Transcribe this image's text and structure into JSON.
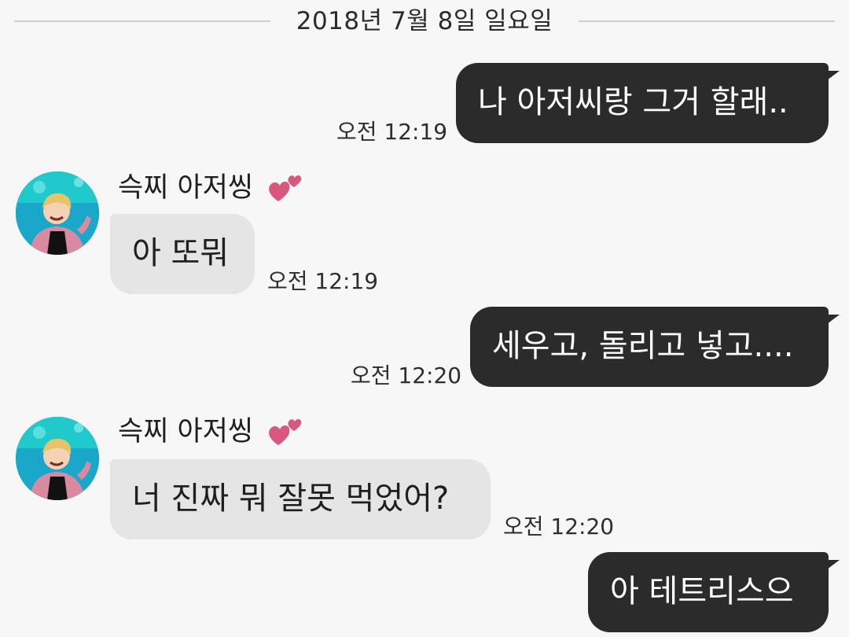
{
  "date_divider": "2018년 7월 8일 일요일",
  "messages": [
    {
      "from": "me",
      "text": "나 아저씨랑 그거 할래..",
      "time": "오전 12:19"
    },
    {
      "from": "contact",
      "sender": "슥찌 아저씽",
      "text": "아 또뭐",
      "time": "오전 12:19"
    },
    {
      "from": "me",
      "text": "세우고, 돌리고 넣고....",
      "time": "오전 12:20"
    },
    {
      "from": "contact",
      "sender": "슥찌 아저씽",
      "text": "너 진짜 뭐 잘못 먹었어?",
      "time": "오전 12:20"
    },
    {
      "from": "me",
      "text": "아 테트리스으",
      "time": ""
    }
  ],
  "icons": {
    "sender_badge": "pink-hearts-icon",
    "avatar": "contact-avatar"
  },
  "colors": {
    "background": "#f7f7f7",
    "outgoing_bubble": "#2b2b2b",
    "incoming_bubble": "#e5e5e5",
    "heart": "#d9577f"
  }
}
